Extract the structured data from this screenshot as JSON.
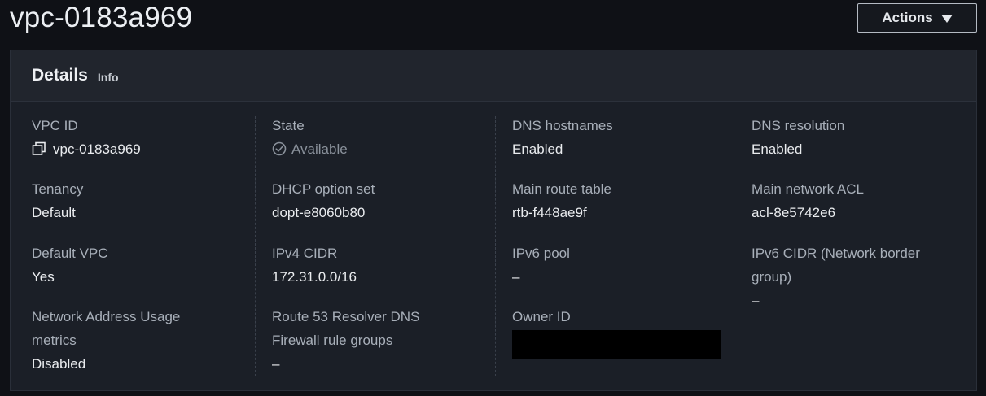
{
  "page": {
    "title": "vpc-0183a969",
    "actions_label": "Actions"
  },
  "details": {
    "title": "Details",
    "info_label": "Info",
    "columns": [
      {
        "fields": [
          {
            "label": "VPC ID",
            "value": "vpc-0183a969"
          },
          {
            "label": "Tenancy",
            "value": "Default"
          },
          {
            "label": "Default VPC",
            "value": "Yes"
          },
          {
            "label_line1": "Network Address Usage",
            "label_line2": "metrics",
            "value": "Disabled"
          }
        ]
      },
      {
        "fields": [
          {
            "label": "State",
            "value": "Available"
          },
          {
            "label": "DHCP option set",
            "value": "dopt-e8060b80"
          },
          {
            "label": "IPv4 CIDR",
            "value": "172.31.0.0/16"
          },
          {
            "label_line1": "Route 53 Resolver DNS",
            "label_line2": "Firewall rule groups",
            "value": "–"
          }
        ]
      },
      {
        "fields": [
          {
            "label": "DNS hostnames",
            "value": "Enabled"
          },
          {
            "label": "Main route table",
            "value": "rtb-f448ae9f"
          },
          {
            "label": "IPv6 pool",
            "value": "–"
          },
          {
            "label": "Owner ID",
            "value": ""
          }
        ]
      },
      {
        "fields": [
          {
            "label": "DNS resolution",
            "value": "Enabled"
          },
          {
            "label": "Main network ACL",
            "value": "acl-8e5742e6"
          },
          {
            "label_line1": "IPv6 CIDR (Network border",
            "label_line2": "group)",
            "value": "–"
          }
        ]
      }
    ]
  },
  "icons": {
    "copy": "copy-icon",
    "status_available": "check-circle-icon",
    "actions_caret": "caret-down-icon"
  },
  "colors": {
    "background": "#0f1116",
    "panel": "#1b1f27",
    "panel_header": "#21252d",
    "label": "#a8afb9",
    "value": "#e9ebee",
    "muted_status": "#8a919b"
  }
}
